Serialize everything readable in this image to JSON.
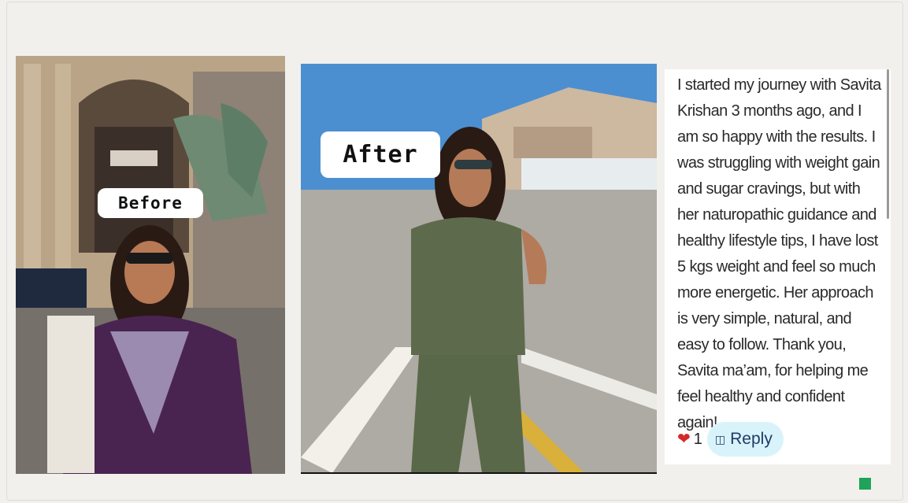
{
  "before_photo": {
    "label": "Before"
  },
  "after_photo": {
    "label": "After"
  },
  "comment": {
    "text": "I started my journey with Savita Krishan 3 months ago, and I am so happy with the results. I was struggling with weight gain and sugar cravings, but with her naturopathic guidance and healthy lifestyle tips, I have lost 5 kgs weight and feel so much more energetic. Her approach is very simple, natural, and easy to follow. Thank you, Savita ma’am, for helping me feel healthy and confident again!",
    "like_icon": "heart-icon",
    "like_count": "1",
    "reply_icon": "reply-icon",
    "reply_label": "Reply"
  },
  "colors": {
    "heart": "#d62828",
    "reply_bg": "#d9f3fb",
    "indicator": "#1fa35a"
  }
}
